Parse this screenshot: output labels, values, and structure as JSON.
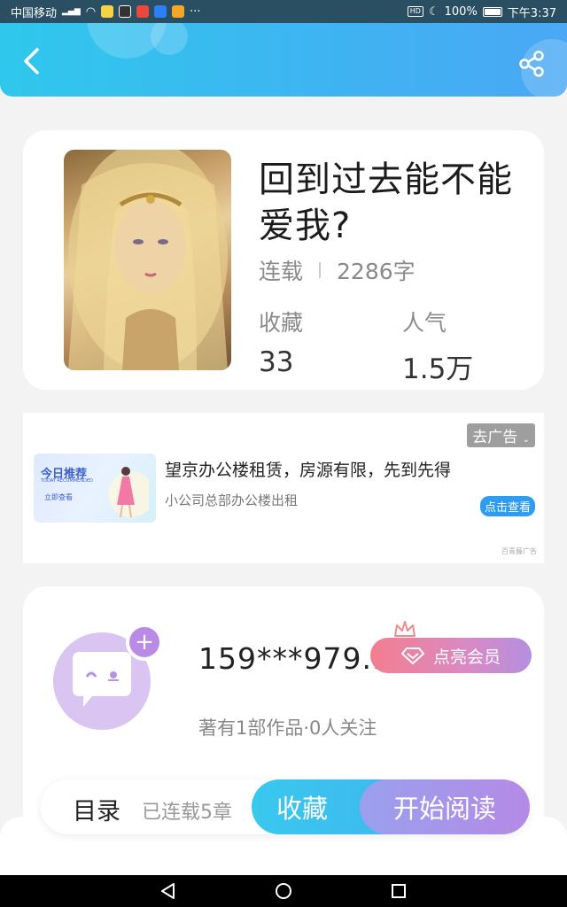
{
  "status_bar": {
    "carrier": "中国移动",
    "network": "4G",
    "more": "···",
    "battery": "100%",
    "time": "下午3:37",
    "hd": "HD"
  },
  "header": {
    "back_icon": "chevron-left-icon",
    "share_icon": "share-icon"
  },
  "book": {
    "title": "回到过去能不能爱我?",
    "status": "连载",
    "word_count": "2286字",
    "favorites_label": "收藏",
    "favorites_value": "33",
    "popularity_label": "人气",
    "popularity_value": "1.5万"
  },
  "ad": {
    "close_label": "去广告",
    "image_title": "今日推荐",
    "image_subtitle": "TODAY RECOMMENDED",
    "image_button": "立即查看",
    "title": "望京办公楼租赁，房源有限，先到先得",
    "description": "小公司总部办公楼出租",
    "button_label": "点击查看",
    "source": "百青藤广告"
  },
  "author": {
    "name": "159***979..",
    "vip_button": "点亮会员",
    "stats": "著有1部作品·0人关注",
    "follow_badge": "+"
  },
  "actions": {
    "toc_label": "目录",
    "chapters_label": "已连载5章",
    "favorite_label": "收藏",
    "read_label": "开始阅读"
  },
  "colors": {
    "header_gradient_start": "#2fc8ec",
    "header_gradient_end": "#4aa8f4",
    "vip_gradient_start": "#f37e8e",
    "vip_gradient_end": "#b48fe0",
    "favorite_button": "#39c8ee",
    "read_button": "#b48ae6"
  }
}
